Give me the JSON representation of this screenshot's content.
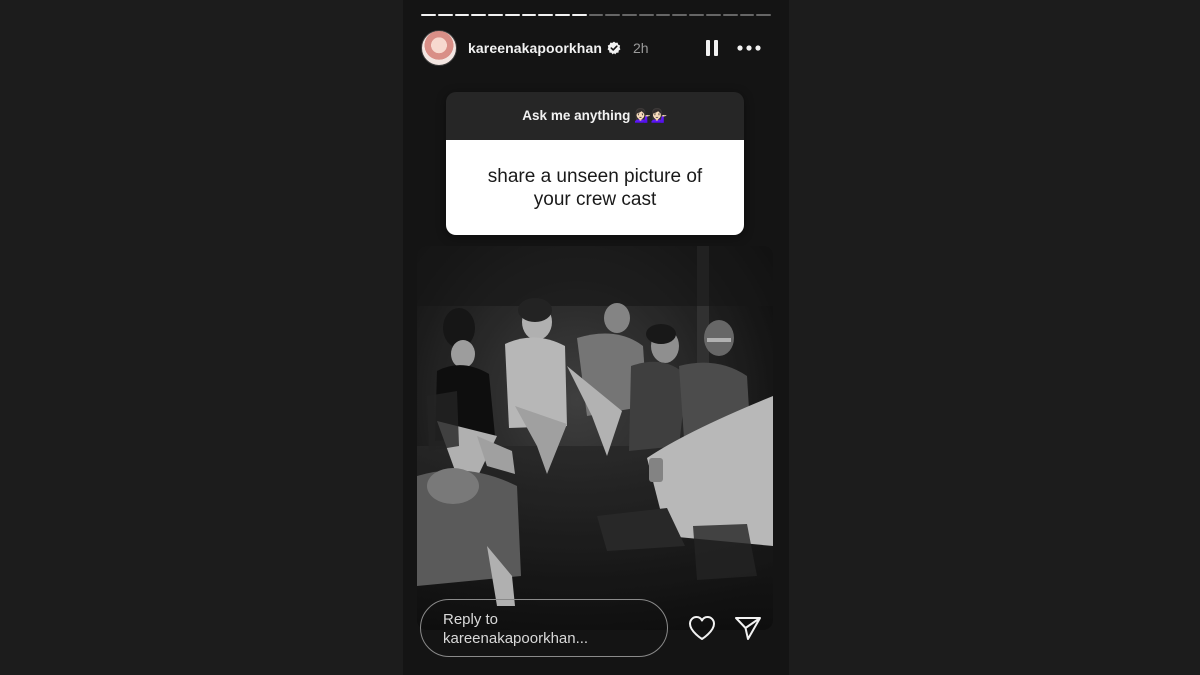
{
  "story": {
    "progress": {
      "total_segments": 21,
      "completed_segments": 10
    },
    "user": {
      "username": "kareenakapoorkhan",
      "verified": true,
      "time_ago": "2h"
    },
    "controls": {
      "pause_icon": "pause-icon",
      "more_icon": "more-options-icon"
    },
    "question_sticker": {
      "prompt": "Ask me anything 💁🏻‍♀️💁🏻‍♀️",
      "answer": "share a unseen picture of your crew cast"
    },
    "photo": {
      "style": "black-and-white",
      "subject": "group seated in a circle"
    },
    "reply": {
      "placeholder_line1": "Reply to",
      "placeholder_line2": "kareenakapoorkhan..."
    },
    "footer_icons": [
      "heart-icon",
      "send-icon"
    ],
    "colors": {
      "background": "#1c1c1c",
      "story_bg": "#141414",
      "text_primary": "#f2f2f2",
      "text_muted": "#9a9a9a"
    }
  }
}
